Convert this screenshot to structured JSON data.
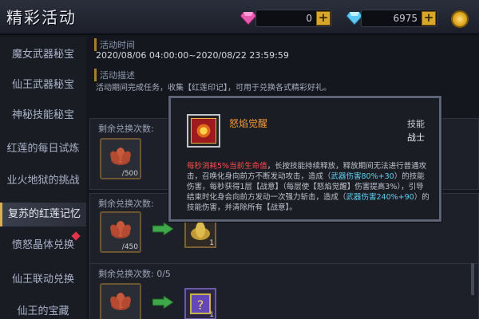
{
  "header": {
    "title": "精彩活动",
    "currency_1": "0",
    "currency_2": "6975",
    "plus": "+"
  },
  "sidebar": {
    "items": [
      {
        "label": "魔女武器秘宝"
      },
      {
        "label": "仙王武器秘宝"
      },
      {
        "label": "神秘技能秘宝"
      },
      {
        "label": "红莲的每日试炼"
      },
      {
        "label": "业火地狱的挑战"
      },
      {
        "label": "复苏的红莲记忆"
      },
      {
        "label": "愤怒晶体兑换"
      },
      {
        "label": "仙王联动兑换"
      },
      {
        "label": "仙王的宝藏"
      }
    ]
  },
  "activity": {
    "time_label": "活动时间",
    "time_value": "2020/08/06 04:00:00~2020/08/22 23:59:59",
    "desc_label": "活动描述",
    "desc_value": "活动期间完成任务，收集【红莲印记】，可用于兑换各式精彩好礼。"
  },
  "cards": [
    {
      "head": "剩余兑换次数:",
      "cost": "/500",
      "reward_count": ""
    },
    {
      "head": "剩余兑换次数:",
      "cost": "/450",
      "reward_count": "1"
    },
    {
      "head": "剩余兑换次数: 0/5",
      "cost": "",
      "reward_count": "1"
    }
  ],
  "popup": {
    "title": "怒焰觉醒",
    "type": "技能",
    "class": "战士",
    "desc_red": "每秒消耗5%当前生命值",
    "desc_1": "，长按技能持续释放，释放期间无法进行普通攻击，召唤化身向前方不断发动攻击，造成（",
    "desc_cyan_1": "武器伤害80%+30",
    "desc_2": "）的技能伤害，每秒获得1层【战意】（每层使【怒焰觉醒】伤害提高3%），引导结束时化身会向前方发动一次强力斩击，造成（",
    "desc_cyan_2": "武器伤害240%+90",
    "desc_3": "）的技能伤害，并清除所有【战意】。"
  },
  "colors": {
    "accent_gold": "#d8a629",
    "skill_title": "#f09a3b",
    "highlight_red": "#ff4b4b",
    "highlight_cyan": "#5fd0f2"
  }
}
